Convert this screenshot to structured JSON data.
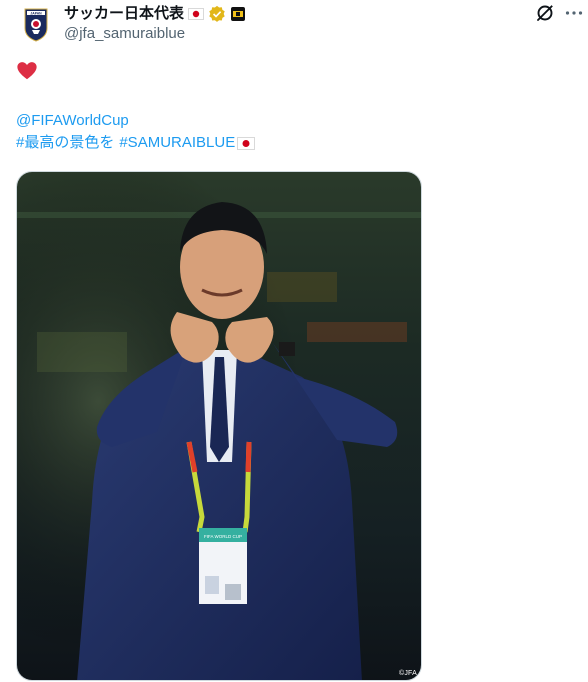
{
  "post": {
    "display_name": "サッカー日本代表",
    "handle": "@jfa_samuraiblue",
    "reaction_emoji": "heart-emoji",
    "mention": "@FIFAWorldCup",
    "line2_prefix": "#最高の景色を",
    "line2_hashtag": "#SAMURAIBLUE",
    "avatar_text": "JAPAN",
    "image_credit": "©JFA",
    "badge_text": "FIFA WORLD CUP"
  },
  "colors": {
    "link": "#1d9bf0",
    "verified_gold": "#e2b719",
    "suit_navy": "#1c2a55",
    "lanyard": "#c7d93b",
    "heart": "#f91880"
  },
  "icons": [
    "avatar-crest-icon",
    "jp-flag-icon",
    "verified-badge-icon",
    "affiliate-badge-icon",
    "grok-icon",
    "more-icon",
    "heart-icon"
  ]
}
